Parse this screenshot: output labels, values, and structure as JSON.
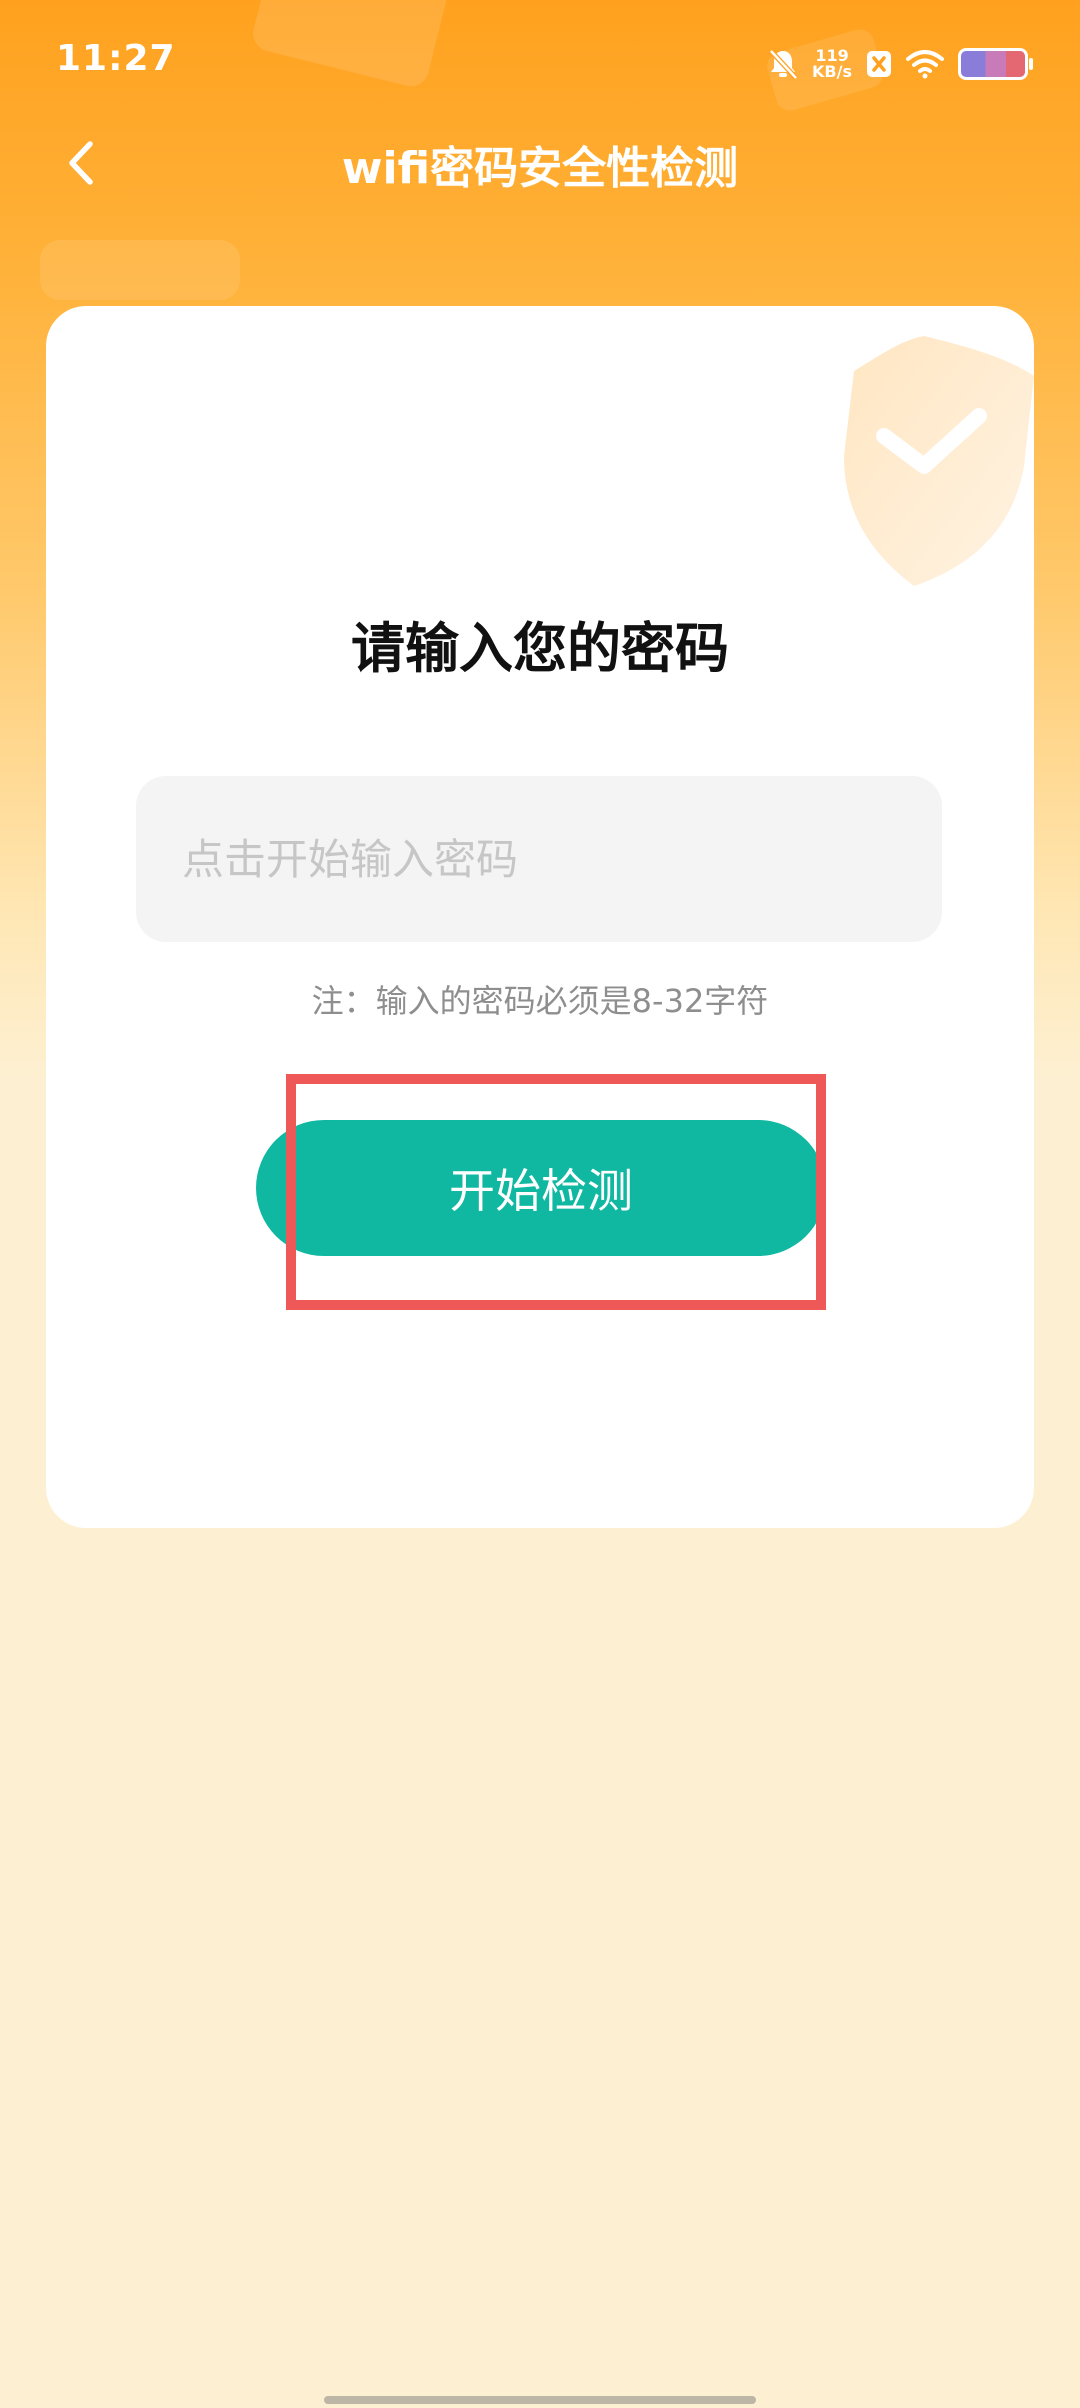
{
  "status_bar": {
    "time": "11:27",
    "net_speed_value": "119",
    "net_speed_unit": "KB/s",
    "battery_colors": [
      "#8A7DD9",
      "#C87BB8",
      "#E46872"
    ]
  },
  "nav": {
    "title": "wifi密码安全性检测"
  },
  "card": {
    "title": "请输入您的密码",
    "input_placeholder": "点击开始输入密码",
    "input_value": "",
    "note": "注：输入的密码必须是8-32字符",
    "start_button_label": "开始检测"
  },
  "colors": {
    "header_gradient_top": "#FFA11E",
    "page_background": "#FDF0D2",
    "button": "#10B8A2",
    "highlight": "#EE5957"
  },
  "icons": {
    "back": "back-arrow-icon",
    "mute": "bell-mute-icon",
    "app": "x-badge-icon",
    "wifi": "wifi-icon",
    "battery": "battery-icon",
    "shield": "shield-check-icon"
  }
}
